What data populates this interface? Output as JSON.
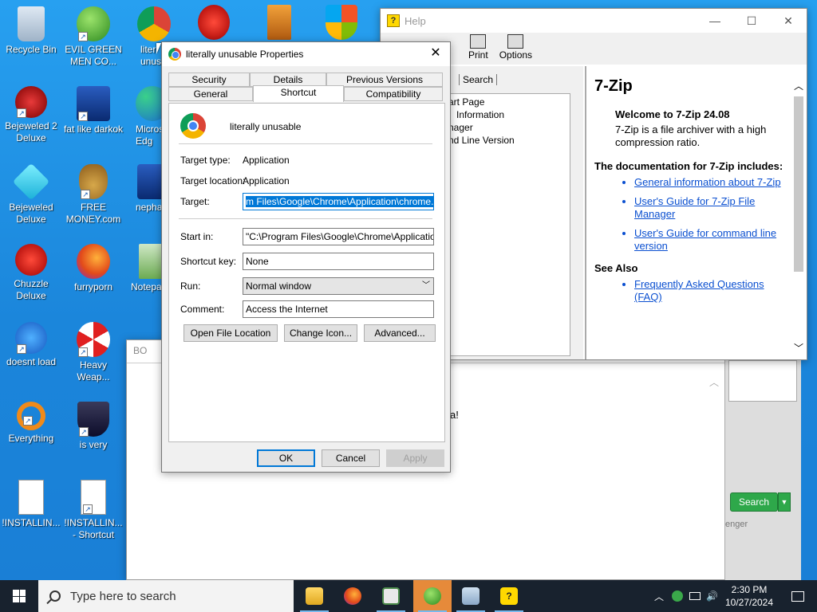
{
  "desktop": {
    "icons": [
      {
        "label": "Recycle Bin"
      },
      {
        "label": "EVIL GREEN MEN CO..."
      },
      {
        "label": "liter unusa"
      },
      {
        "label": "Bejeweled 2 Deluxe"
      },
      {
        "label": "fat like darkok"
      },
      {
        "label": "Micros Edg"
      },
      {
        "label": "Bejeweled Deluxe"
      },
      {
        "label": "FREE MONEY.com"
      },
      {
        "label": "nepha"
      },
      {
        "label": "Chuzzle Deluxe"
      },
      {
        "label": "furryporn"
      },
      {
        "label": "Notepa"
      },
      {
        "label": "doesnt load"
      },
      {
        "label": "Heavy Weap..."
      },
      {
        "label": "Everything"
      },
      {
        "label": "is very"
      },
      {
        "label": "!INSTALLIN..."
      },
      {
        "label": "!INSTALLIN... - Shortcut"
      }
    ]
  },
  "help": {
    "title": "Help",
    "toolbar": {
      "print": "Print",
      "options": "Options"
    },
    "nav": {
      "search_tab": "Search",
      "tree": [
        "art Page",
        "Information",
        "nager",
        "nd Line Version"
      ]
    },
    "content": {
      "heading": "7-Zip",
      "welcome": "Welcome to 7-Zip 24.08",
      "intro": "7-Zip is a file archiver with a high compression ratio.",
      "docs_heading": "The documentation for 7-Zip includes:",
      "links": [
        "General information about 7-Zip",
        "User's Guide for 7-Zip File Manager",
        "User's Guide for command line version"
      ],
      "see_also": "See Also",
      "faq": "Frequently Asked Questions (FAQ)"
    }
  },
  "bgwin": {
    "title": "BO",
    "fragment": "a!",
    "search_button": "Search",
    "footer_label": "enger"
  },
  "props": {
    "title": "literally unusable Properties",
    "tabs_row1": [
      "Security",
      "Details",
      "Previous Versions"
    ],
    "tabs_row2": [
      "General",
      "Shortcut",
      "Compatibility"
    ],
    "name": "literally unusable",
    "target_type_label": "Target type:",
    "target_type": "Application",
    "target_location_label": "Target location:",
    "target_location": "Application",
    "target_label": "Target:",
    "target": "m Files\\Google\\Chrome\\Application\\chrome.exe\"",
    "start_in_label": "Start in:",
    "start_in": "\"C:\\Program Files\\Google\\Chrome\\Application\"",
    "shortcut_key_label": "Shortcut key:",
    "shortcut_key": "None",
    "run_label": "Run:",
    "run": "Normal window",
    "comment_label": "Comment:",
    "comment": "Access the Internet",
    "open_location": "Open File Location",
    "change_icon": "Change Icon...",
    "advanced": "Advanced...",
    "ok": "OK",
    "cancel": "Cancel",
    "apply": "Apply"
  },
  "taskbar": {
    "search_placeholder": "Type here to search",
    "time": "2:30 PM",
    "date": "10/27/2024"
  }
}
